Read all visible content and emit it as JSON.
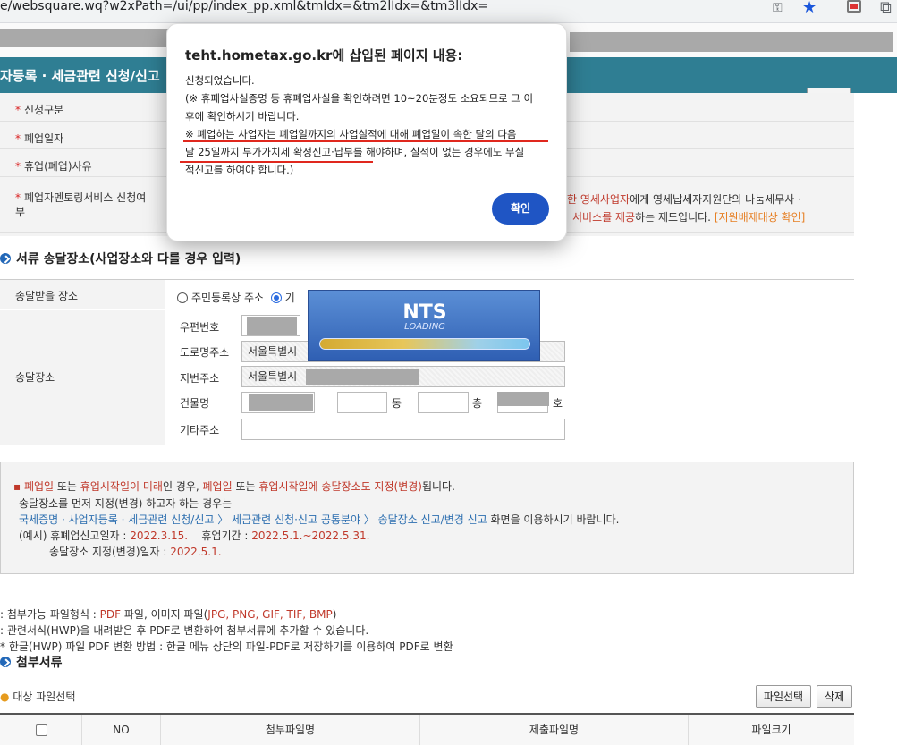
{
  "browser": {
    "url": "e/websquare.wq?w2xPath=/ui/pp/index_pp.xml&tmIdx=&tm2lIdx=&tm3lIdx=",
    "key_icon": "key-icon",
    "star_icon": "star-icon"
  },
  "page": {
    "title": "자등록 · 세금관련 신청/신고"
  },
  "form": {
    "rows": [
      {
        "label": "신청구분"
      },
      {
        "label": "폐업일자"
      },
      {
        "label": "휴업(폐업)사유"
      },
      {
        "label_line1": "폐업자멘토링서비스 신청여",
        "label_line2": "부"
      }
    ],
    "mentoring_text_line1_red": "한 영세사업자",
    "mentoring_text_line1": "에게 영세납세자지원단의 나눔세무사 ·",
    "mentoring_text_line2_red": "서비스를 제공",
    "mentoring_text_line2": "하는 제도입니다.",
    "mentoring_link": "[지원배제대상 확인]"
  },
  "delivery": {
    "section_title": "서류 송달장소(사업장소와 다를 경우 입력)",
    "place_label": "송달받을 장소",
    "radio_resident": "주민등록상 주소",
    "radio_other": "기",
    "address_label": "송달장소",
    "postcode_label": "우편번호",
    "road_label": "도로명주소",
    "road_value": "서울특별시",
    "jibun_label": "지번주소",
    "jibun_value": "서울특별시",
    "building_label": "건물명",
    "dong_unit": "동",
    "floor_unit": "층",
    "ho_unit": "호",
    "other_label": "기타주소"
  },
  "notice": {
    "line1_a": "폐업일",
    "line1_b": " 또는 ",
    "line1_c": "휴업시작일이 미래",
    "line1_d": "인 경우, ",
    "line1_e": "폐업일",
    "line1_f": " 또는 ",
    "line1_g": "휴업시작일에 송달장소도 지정(변경)",
    "line1_h": "됩니다.",
    "line2": "송달장소를 먼저 지정(변경) 하고자 하는 경우는",
    "line3_link": "국세증명 · 사업자등록 · 세금관련 신청/신고 〉 세금관련 신청·신고 공통분야 〉 송달장소 신고/변경 신고",
    "line3_tail": " 화면을 이용하시기 바랍니다.",
    "line4_a": "(예시) 휴폐업신고일자 : ",
    "line4_b": "2022.3.15.",
    "line4_c": "휴업기간 : ",
    "line4_d": "2022.5.1.~2022.5.31.",
    "line5_a": "송달장소 지정(변경)일자 : ",
    "line5_b": "2022.5.1."
  },
  "attachments": {
    "help1_a": "첨부가능 파일형식 : ",
    "help1_b": "PDF",
    "help1_c": " 파일, 이미지 파일(",
    "help1_d": "JPG, PNG, GIF, TIF, BMP",
    "help1_e": ")",
    "help2": "관련서식(HWP)을 내려받은 후 PDF로 변환하여 첨부서류에 추가할 수 있습니다.",
    "help3": "* 한글(HWP) 파일 PDF 변환 방법 : 한글 메뉴 상단의 파일-PDF로 저장하기를 이용하여 PDF로 변환",
    "section_title": "첨부서류",
    "target_label": "대상 파일선택",
    "select_button": "파일선택",
    "delete_button": "삭제",
    "columns": [
      "NO",
      "첨부파일명",
      "제출파일명",
      "파일크기"
    ]
  },
  "loading": {
    "brand": "NTS",
    "text": "LOADING"
  },
  "modal": {
    "title": "teht.hometax.go.kr에 삽입된 페이지 내용:",
    "line1": "신청되었습니다.",
    "line2": "(※ 휴폐업사실증명 등 휴폐업사실을 확인하려면 10~20분정도 소요되므로 그 이",
    "line3": "후에 확인하시기 바랍니다.",
    "line4": " ※ 폐업하는 사업자는 폐업일까지의 사업실적에 대해 폐업일이 속한 달의 다음",
    "line5": "달 25일까지 부가가치세 확정신고·납부를 해야하며, 실적이 없는 경우에도 무실",
    "line6": "적신고를 하여야 합니다.)",
    "ok_button": "확인"
  },
  "colors": {
    "title_bar": "#2f7e93",
    "ok_button": "#1f55c4",
    "underline": "#e0281e"
  }
}
